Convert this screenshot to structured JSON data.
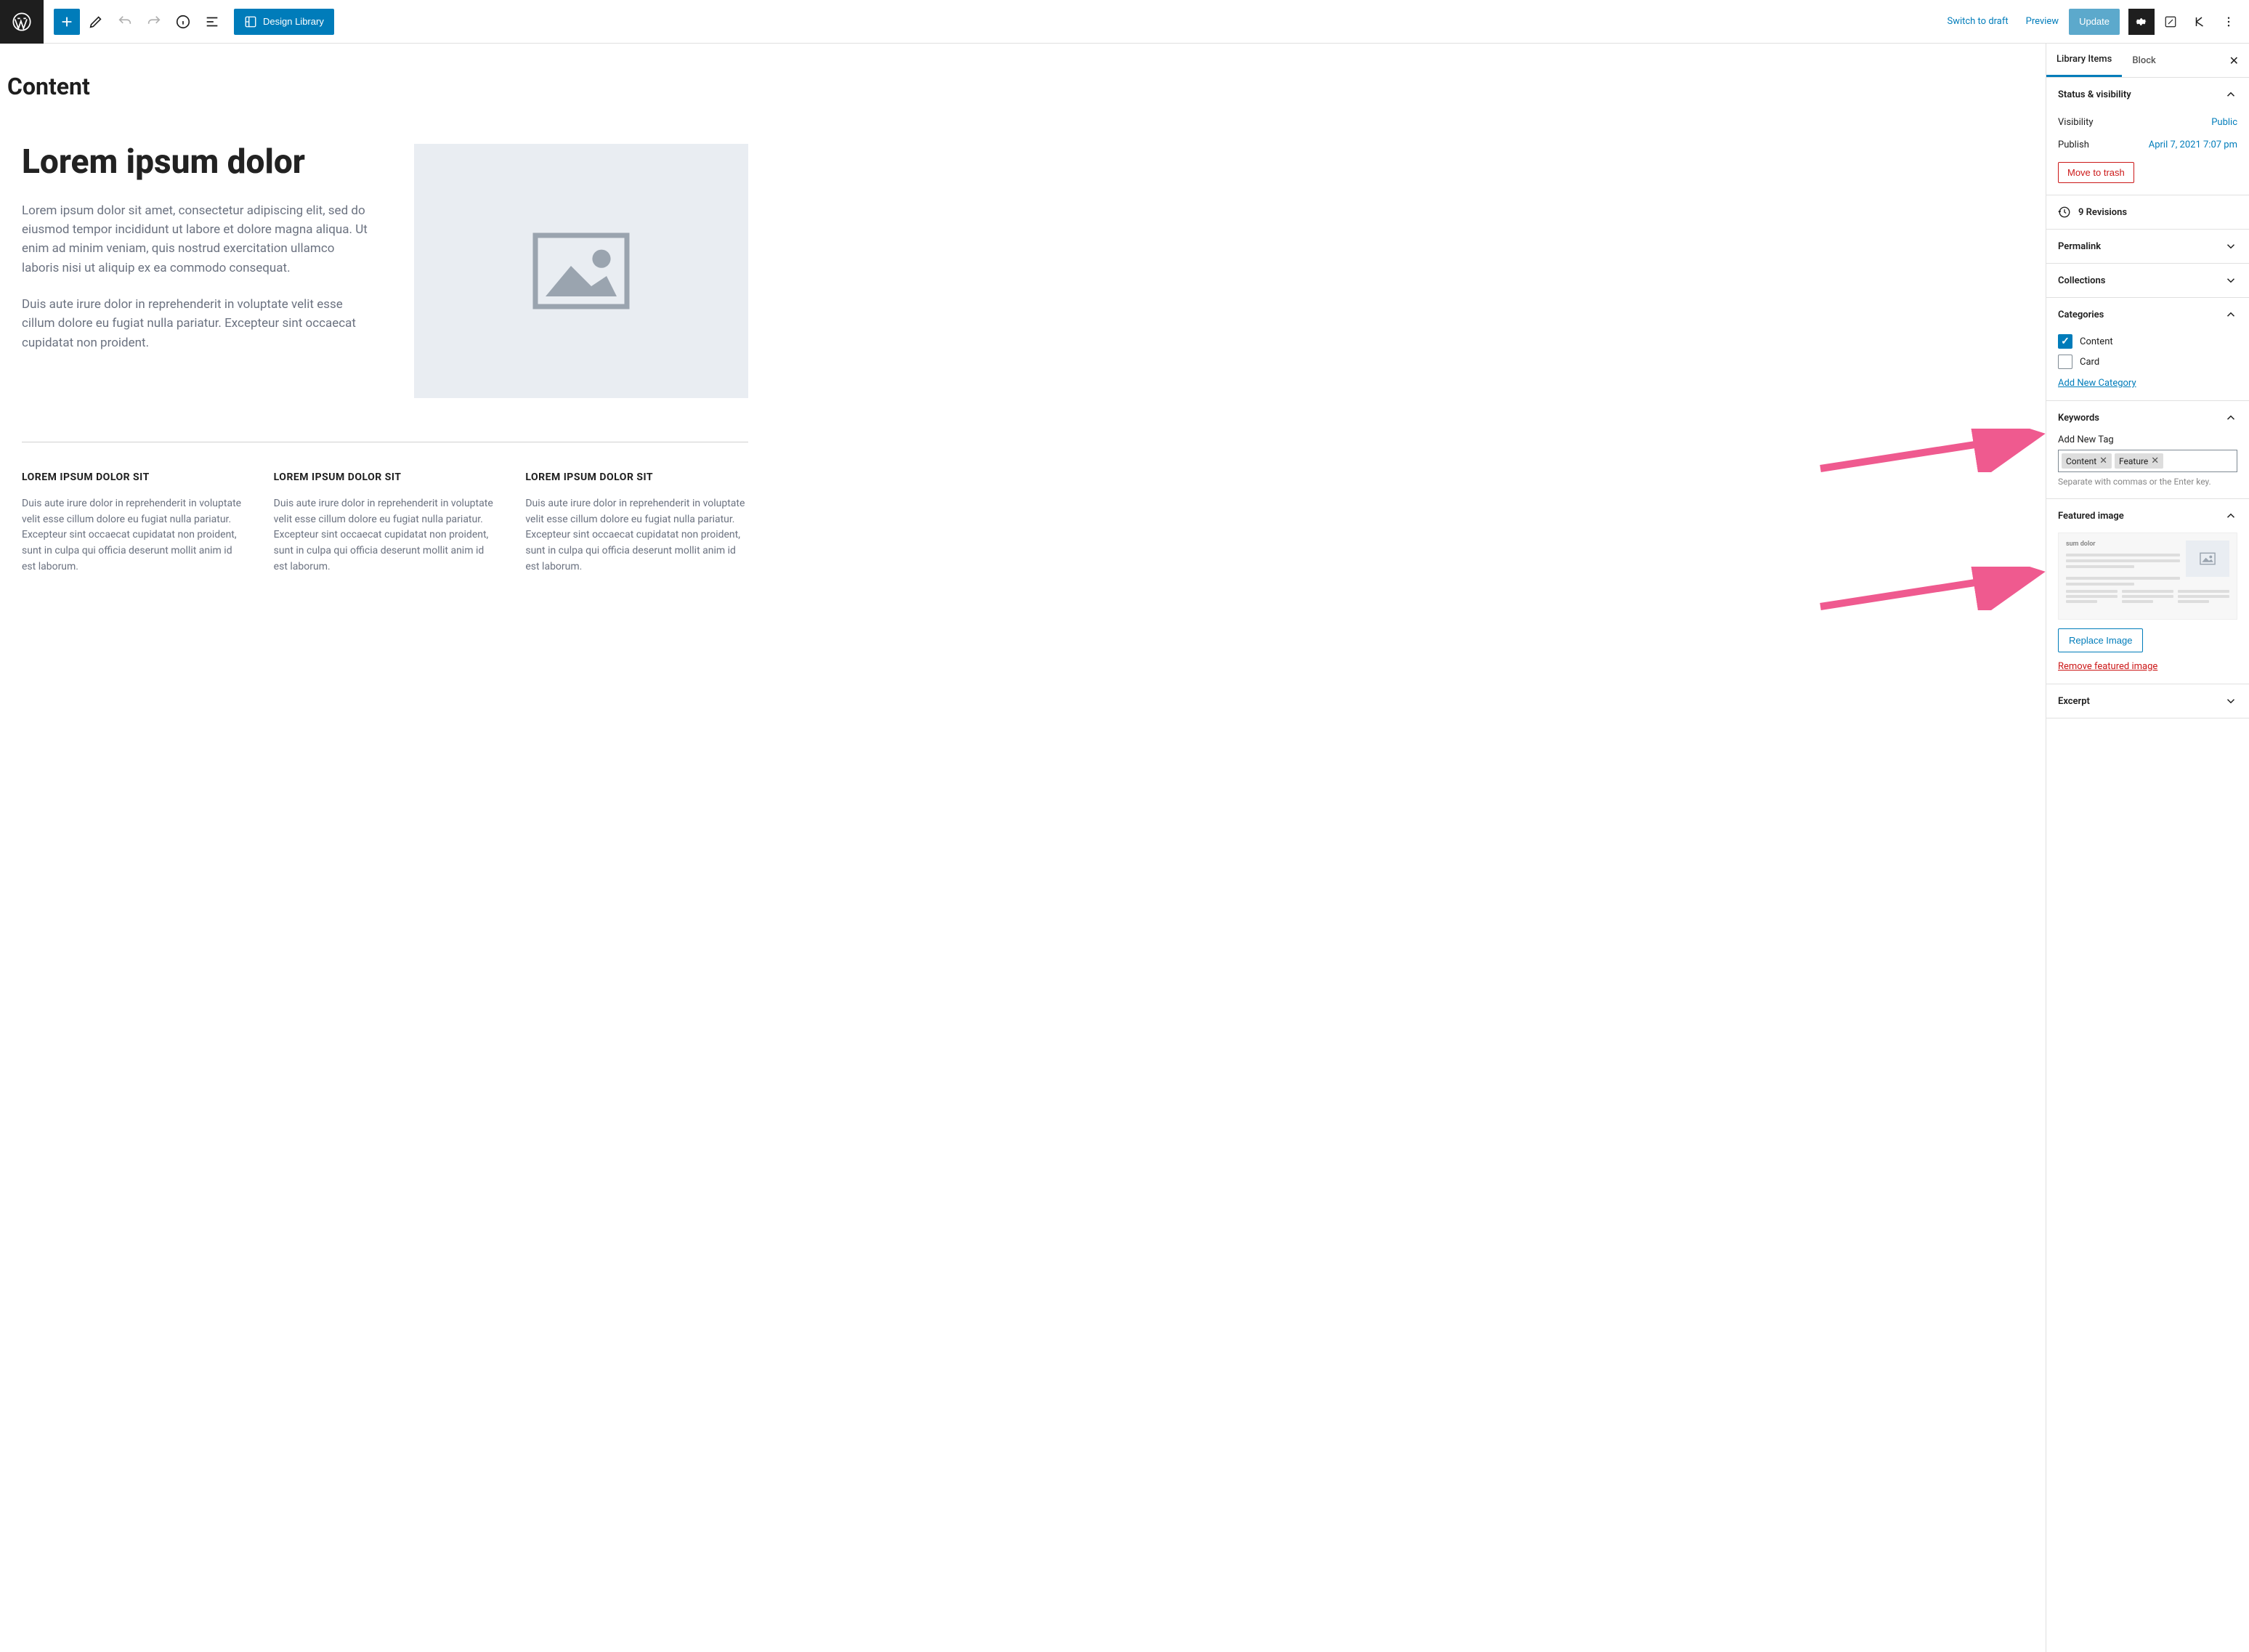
{
  "toolbar": {
    "design_library_label": "Design Library",
    "switch_draft": "Switch to draft",
    "preview": "Preview",
    "update": "Update"
  },
  "page": {
    "title": "Content",
    "hero_heading": "Lorem ipsum dolor",
    "hero_p1": "Lorem ipsum dolor sit amet, consectetur adipiscing elit, sed do eiusmod tempor incididunt ut labore et dolore magna aliqua. Ut enim ad minim veniam, quis nostrud exercitation ullamco laboris nisi ut aliquip ex ea commodo consequat.",
    "hero_p2": "Duis aute irure dolor in reprehenderit in voluptate velit esse cillum dolore eu fugiat nulla pariatur. Excepteur sint occaecat cupidatat non proident.",
    "col_heading": "LOREM IPSUM DOLOR SIT",
    "col_body": "Duis aute irure dolor in reprehenderit in voluptate velit esse cillum dolore eu fugiat nulla pariatur. Excepteur sint occaecat cupidatat non proident, sunt in culpa qui officia deserunt mollit anim id est laborum."
  },
  "sidebar": {
    "tabs": {
      "library": "Library Items",
      "block": "Block"
    },
    "status": {
      "title": "Status & visibility",
      "visibility_label": "Visibility",
      "visibility_value": "Public",
      "publish_label": "Publish",
      "publish_value": "April 7, 2021 7:07 pm",
      "trash": "Move to trash"
    },
    "revisions": "9 Revisions",
    "permalink": "Permalink",
    "collections": "Collections",
    "categories": {
      "title": "Categories",
      "items": [
        {
          "label": "Content",
          "checked": true
        },
        {
          "label": "Card",
          "checked": false
        }
      ],
      "add": "Add New Category"
    },
    "keywords": {
      "title": "Keywords",
      "add_label": "Add New Tag",
      "tags": [
        "Content",
        "Feature"
      ],
      "help": "Separate with commas or the Enter key."
    },
    "featured": {
      "title": "Featured image",
      "thumb_title": "sum dolor",
      "replace": "Replace Image",
      "remove": "Remove featured image"
    },
    "excerpt": "Excerpt"
  }
}
